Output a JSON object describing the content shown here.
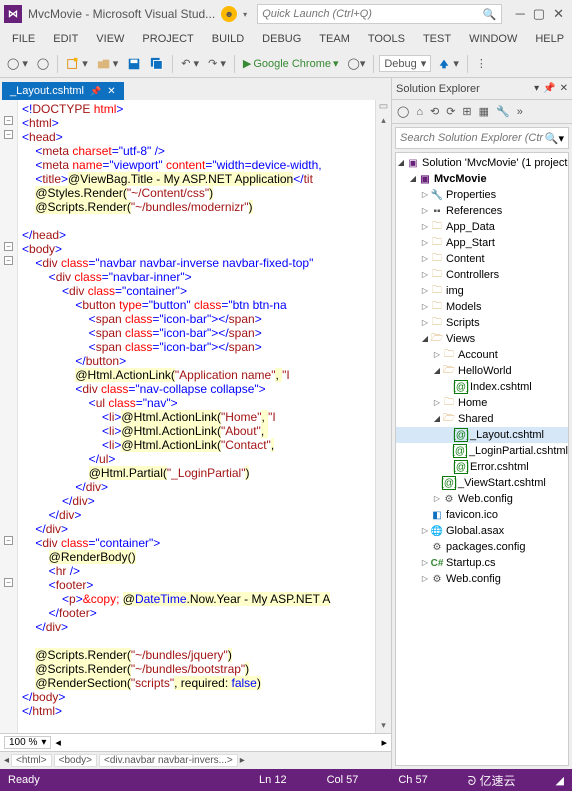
{
  "titlebar": {
    "title": "MvcMovie - Microsoft Visual Stud...",
    "quicklaunch_placeholder": "Quick Launch (Ctrl+Q)"
  },
  "menu": [
    "FILE",
    "EDIT",
    "VIEW",
    "PROJECT",
    "BUILD",
    "DEBUG",
    "TEAM",
    "TOOLS",
    "TEST",
    "WINDOW",
    "HELP"
  ],
  "toolbar": {
    "browser": "Google Chrome",
    "config": "Debug"
  },
  "tab": {
    "name": "_Layout.cshtml"
  },
  "zoom": "100 %",
  "breadcrumbs": [
    "<html>",
    "<body>",
    "<div.navbar navbar-invers...>"
  ],
  "solexp": {
    "title": "Solution Explorer",
    "search_placeholder": "Search Solution Explorer (Ctr",
    "solution": "Solution 'MvcMovie' (1 project",
    "project": "MvcMovie",
    "items": {
      "properties": "Properties",
      "references": "References",
      "appdata": "App_Data",
      "appstart": "App_Start",
      "content": "Content",
      "controllers": "Controllers",
      "img": "img",
      "models": "Models",
      "scripts": "Scripts",
      "views": "Views",
      "account": "Account",
      "helloworld": "HelloWorld",
      "index": "Index.cshtml",
      "home": "Home",
      "shared": "Shared",
      "layout": "_Layout.cshtml",
      "loginpartial": "_LoginPartial.cshtml",
      "error": "Error.cshtml",
      "viewstart": "_ViewStart.cshtml",
      "webconfig_v": "Web.config",
      "favicon": "favicon.ico",
      "globalasax": "Global.asax",
      "packages": "packages.config",
      "startup": "Startup.cs",
      "webconfig": "Web.config"
    }
  },
  "statusbar": {
    "ready": "Ready",
    "ln": "Ln 12",
    "col": "Col 57",
    "ch": "Ch 57",
    "brand": "亿速云"
  },
  "code": {
    "l1a": "<!",
    "l1b": "DOCTYPE",
    "l1c": " html",
    "l1d": ">",
    "l2a": "<",
    "l2b": "html",
    "l2c": ">",
    "l3a": "<",
    "l3b": "head",
    "l3c": ">",
    "l4a": "    <",
    "l4b": "meta",
    "l4c": " charset",
    "l4d": "=\"utf-8\"",
    "l4e": " />",
    "l5a": "    <",
    "l5b": "meta",
    "l5c": " name",
    "l5d": "=\"viewport\"",
    "l5e": " content",
    "l5f": "=\"width=device-width,",
    "l6a": "    <",
    "l6b": "title",
    "l6c": ">",
    "l6d": "@",
    "l6e": "ViewBag.Title - My ASP.NET Application",
    "l6f": "</",
    "l6g": "tit",
    "l7a": "    ",
    "l7b": "@",
    "l7c": "Styles.Render(",
    "l7d": "\"~/Content/css\"",
    "l7e": ")",
    "l8a": "    ",
    "l8b": "@",
    "l8c": "Scripts.Render(",
    "l8d": "\"~/bundles/modernizr\"",
    "l8e": ")",
    "l10a": "</",
    "l10b": "head",
    "l10c": ">",
    "l11a": "<",
    "l11b": "body",
    "l11c": ">",
    "l12a": "    <",
    "l12b": "div",
    "l12c": " class",
    "l12d": "=\"navbar navbar-inverse navbar-fixed-top\"",
    "l13a": "        <",
    "l13b": "div",
    "l13c": " class",
    "l13d": "=\"navbar-inner\"",
    "l13e": ">",
    "l14a": "            <",
    "l14b": "div",
    "l14c": " class",
    "l14d": "=\"container\"",
    "l14e": ">",
    "l15a": "                <",
    "l15b": "button",
    "l15c": " type",
    "l15d": "=\"button\"",
    "l15e": " class",
    "l15f": "=\"btn btn-na",
    "l16a": "                    <",
    "l16b": "span",
    "l16c": " class",
    "l16d": "=\"icon-bar\"",
    "l16e": "></",
    "l16f": "span",
    "l16g": ">",
    "l17a": "                    <",
    "l17b": "span",
    "l17c": " class",
    "l17d": "=\"icon-bar\"",
    "l17e": "></",
    "l17f": "span",
    "l17g": ">",
    "l18a": "                    <",
    "l18b": "span",
    "l18c": " class",
    "l18d": "=\"icon-bar\"",
    "l18e": "></",
    "l18f": "span",
    "l18g": ">",
    "l19a": "                </",
    "l19b": "button",
    "l19c": ">",
    "l20a": "                ",
    "l20b": "@",
    "l20c": "Html.ActionLink(",
    "l20d": "\"Application name\"",
    "l20e": ", ",
    "l20f": "\"I",
    "l21a": "                <",
    "l21b": "div",
    "l21c": " class",
    "l21d": "=\"nav-collapse collapse\"",
    "l21e": ">",
    "l22a": "                    <",
    "l22b": "ul",
    "l22c": " class",
    "l22d": "=\"nav\"",
    "l22e": ">",
    "l23a": "                        <",
    "l23b": "li",
    "l23c": ">",
    "l23d": "@",
    "l23e": "Html.ActionLink(",
    "l23f": "\"Home\"",
    "l23g": ", ",
    "l23h": "\"I",
    "l24a": "                        <",
    "l24b": "li",
    "l24c": ">",
    "l24d": "@",
    "l24e": "Html.ActionLink(",
    "l24f": "\"About\"",
    "l24g": ", ",
    "l25a": "                        <",
    "l25b": "li",
    "l25c": ">",
    "l25d": "@",
    "l25e": "Html.ActionLink(",
    "l25f": "\"Contact\"",
    "l25g": ",",
    "l26a": "                    </",
    "l26b": "ul",
    "l26c": ">",
    "l27a": "                    ",
    "l27b": "@",
    "l27c": "Html.Partial(",
    "l27d": "\"_LoginPartial\"",
    "l27e": ")",
    "l28a": "                </",
    "l28b": "div",
    "l28c": ">",
    "l29a": "            </",
    "l29b": "div",
    "l29c": ">",
    "l30a": "        </",
    "l30b": "div",
    "l30c": ">",
    "l31a": "    </",
    "l31b": "div",
    "l31c": ">",
    "l32a": "    <",
    "l32b": "div",
    "l32c": " class",
    "l32d": "=\"container\"",
    "l32e": ">",
    "l33a": "        ",
    "l33b": "@",
    "l33c": "RenderBody()",
    "l34a": "        <",
    "l34b": "hr",
    "l34c": " />",
    "l35a": "        <",
    "l35b": "footer",
    "l35c": ">",
    "l36a": "            <",
    "l36b": "p",
    "l36c": ">",
    "l36d": "&copy;",
    "l36e": " ",
    "l36f": "@",
    "l36g": "DateTime",
    "l36h": ".Now.Year - My ASP.NET A",
    "l37a": "        </",
    "l37b": "footer",
    "l37c": ">",
    "l38a": "    </",
    "l38b": "div",
    "l38c": ">",
    "l40a": "    ",
    "l40b": "@",
    "l40c": "Scripts.Render(",
    "l40d": "\"~/bundles/jquery\"",
    "l40e": ")",
    "l41a": "    ",
    "l41b": "@",
    "l41c": "Scripts.Render(",
    "l41d": "\"~/bundles/bootstrap\"",
    "l41e": ")",
    "l42a": "    ",
    "l42b": "@",
    "l42c": "RenderSection(",
    "l42d": "\"scripts\"",
    "l42e": ", required: ",
    "l42f": "false",
    "l42g": ")",
    "l43a": "</",
    "l43b": "body",
    "l43c": ">",
    "l44a": "</",
    "l44b": "html",
    "l44c": ">"
  }
}
